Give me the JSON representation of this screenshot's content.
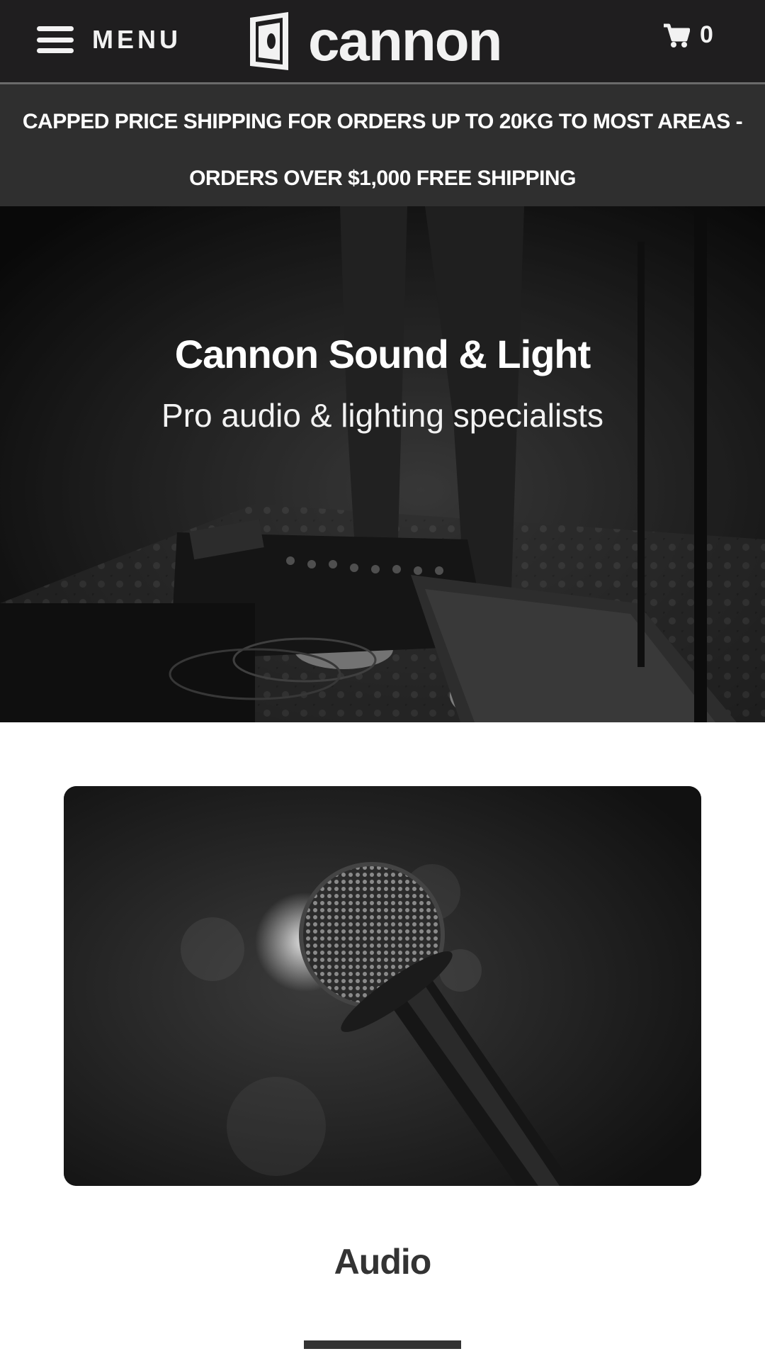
{
  "header": {
    "menu_label": "MENU",
    "brand": "cannon",
    "cart_count": "0",
    "icons": [
      "hamburger-icon",
      "logo-mark-icon",
      "cart-icon"
    ]
  },
  "announcement": {
    "line1": "CAPPED PRICE SHIPPING FOR ORDERS UP TO 20KG TO MOST AREAS -",
    "line2": "ORDERS OVER $1,000 FREE SHIPPING"
  },
  "hero": {
    "title": "Cannon Sound & Light",
    "subtitle": "Pro audio & lighting specialists"
  },
  "categories": [
    {
      "title": "Audio"
    }
  ],
  "colors": {
    "header_bg": "#1f1e1f",
    "announce_bg": "#2f2f2f",
    "text_dark": "#333333",
    "text_light": "#f2f2f2"
  }
}
